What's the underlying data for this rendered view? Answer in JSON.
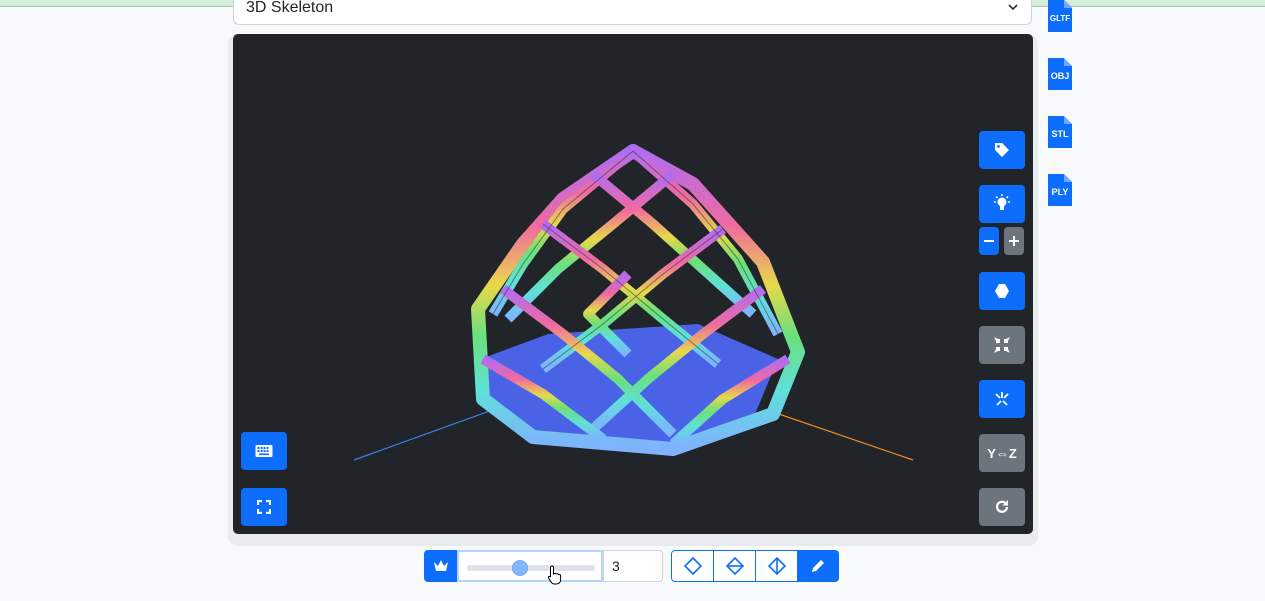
{
  "model_select": {
    "value": "3D Skeleton"
  },
  "export_formats": [
    "GLTF",
    "OBJ",
    "STL",
    "PLY"
  ],
  "viewer": {
    "right_controls": [
      "tag-icon",
      "lightbulb-icon",
      "minus-icon",
      "plus-icon",
      "polygon-icon",
      "compress-icon",
      "explode-icon",
      "swap-yz",
      "rotate-icon"
    ],
    "swap_label": "Y⇔Z",
    "left_controls": [
      "keyboard-icon",
      "fullscreen-icon"
    ]
  },
  "toolbar": {
    "slider_value": 0.4,
    "level_value": "3",
    "buttons": [
      "crown-icon",
      "diamond-icon",
      "diamond-horizontal-icon",
      "diamond-vertical-icon",
      "pencil-icon"
    ]
  },
  "colors": {
    "accent": "#0d6efd",
    "secondary": "#6c757d",
    "viewer_bg": "#212529"
  }
}
